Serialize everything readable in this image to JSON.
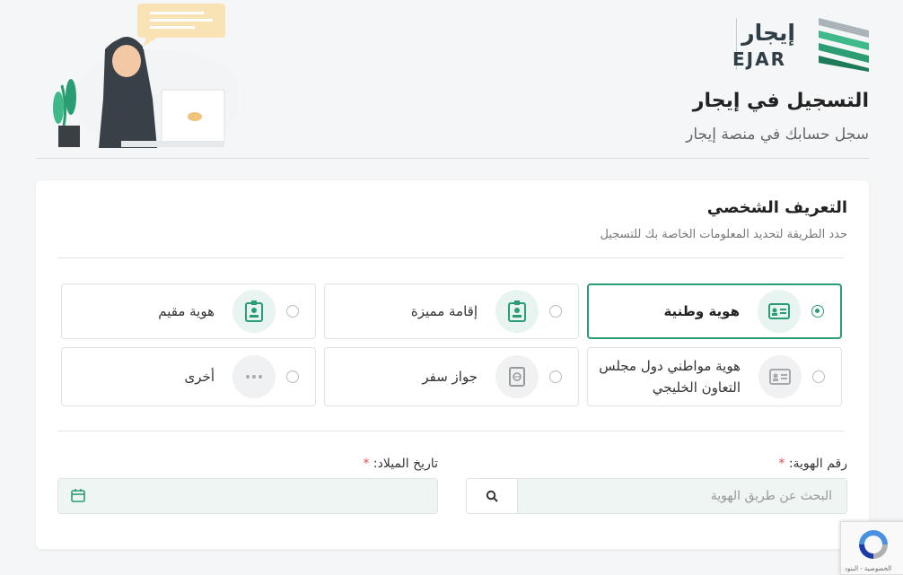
{
  "brand": {
    "name_ar": "إيجار",
    "name_en": "EJAR"
  },
  "page": {
    "title": "التسجيل في إيجار",
    "subtitle": "سجل حسابك في منصة إيجار"
  },
  "section": {
    "title": "التعريف الشخصي",
    "subtitle": "حدد الطريقة لتحديد المعلومات الخاصة بك للتسجيل"
  },
  "options": [
    {
      "label": "هوية وطنية",
      "icon": "id-card-icon",
      "selected": true
    },
    {
      "label": "إقامة مميزة",
      "icon": "badge-icon",
      "selected": false
    },
    {
      "label": "هوية مقيم",
      "icon": "badge-icon",
      "selected": false
    },
    {
      "label": "هوية مواطني دول مجلس",
      "label2": "التعاون الخليجي",
      "icon": "id-card-icon",
      "selected": false
    },
    {
      "label": "جواز سفر",
      "icon": "passport-icon",
      "selected": false
    },
    {
      "label": "أخرى",
      "icon": "more-icon",
      "selected": false
    }
  ],
  "form": {
    "id_label": "رقم الهوية:",
    "id_placeholder": "البحث عن طريق الهوية",
    "dob_label": "تاريخ الميلاد:",
    "required_mark": "*"
  },
  "recaptcha": {
    "text": "الخصوصية - البنود"
  },
  "colors": {
    "accent": "#2a9d72",
    "required": "#d9534f",
    "field_bg": "#eef5f2"
  }
}
